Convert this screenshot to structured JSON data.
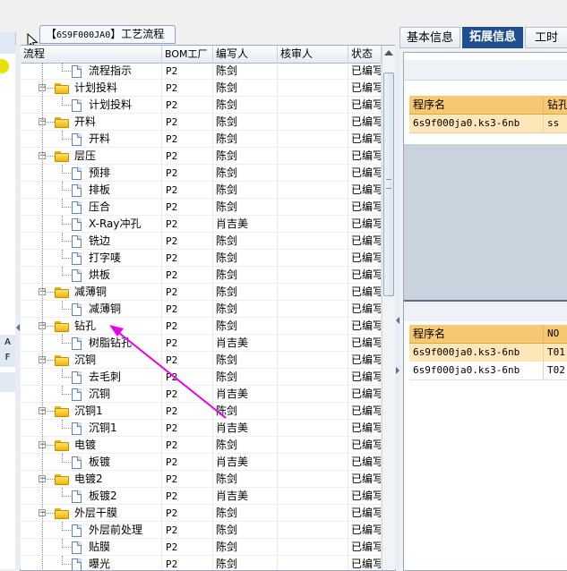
{
  "title_tab": {
    "code": "6S9F000JA0",
    "prefix": "【",
    "suffix": "】工艺流程"
  },
  "right_tabs": [
    {
      "label": "基本信息",
      "active": false
    },
    {
      "label": "拓展信息",
      "active": true
    },
    {
      "label": "工时",
      "active": false
    }
  ],
  "left_strip": {
    "text_a": "A",
    "text_b": "F"
  },
  "grid": {
    "headers": {
      "flow": "流程",
      "bom": "BOM工厂",
      "author": "编写人",
      "reviewer": "核审人",
      "status": "状态"
    },
    "rows": [
      {
        "level": 2,
        "name": "流程指示",
        "bom": "P2",
        "author": "陈剑",
        "reviewer": "",
        "status": "已编写"
      },
      {
        "level": 1,
        "name": "计划投料",
        "bom": "P2",
        "author": "陈剑",
        "reviewer": "",
        "status": "已编写"
      },
      {
        "level": 2,
        "name": "计划投料",
        "bom": "P2",
        "author": "陈剑",
        "reviewer": "",
        "status": "已编写"
      },
      {
        "level": 1,
        "name": "开料",
        "bom": "P2",
        "author": "陈剑",
        "reviewer": "",
        "status": "已编写"
      },
      {
        "level": 2,
        "name": "开料",
        "bom": "P2",
        "author": "陈剑",
        "reviewer": "",
        "status": "已编写"
      },
      {
        "level": 1,
        "name": "层压",
        "bom": "P2",
        "author": "陈剑",
        "reviewer": "",
        "status": "已编写"
      },
      {
        "level": 2,
        "name": "预排",
        "bom": "P2",
        "author": "陈剑",
        "reviewer": "",
        "status": "已编写"
      },
      {
        "level": 2,
        "name": "排板",
        "bom": "P2",
        "author": "陈剑",
        "reviewer": "",
        "status": "已编写"
      },
      {
        "level": 2,
        "name": "压合",
        "bom": "P2",
        "author": "陈剑",
        "reviewer": "",
        "status": "已编写"
      },
      {
        "level": 2,
        "name": "X-Ray冲孔",
        "bom": "P2",
        "author": "肖吉美",
        "reviewer": "",
        "status": "已编写"
      },
      {
        "level": 2,
        "name": "铣边",
        "bom": "P2",
        "author": "陈剑",
        "reviewer": "",
        "status": "已编写"
      },
      {
        "level": 2,
        "name": "打字唛",
        "bom": "P2",
        "author": "陈剑",
        "reviewer": "",
        "status": "已编写"
      },
      {
        "level": 2,
        "name": "烘板",
        "bom": "P2",
        "author": "陈剑",
        "reviewer": "",
        "status": "已编写"
      },
      {
        "level": 1,
        "name": "减薄铜",
        "bom": "P2",
        "author": "陈剑",
        "reviewer": "",
        "status": "已编写"
      },
      {
        "level": 2,
        "name": "减薄铜",
        "bom": "P2",
        "author": "陈剑",
        "reviewer": "",
        "status": "已编写"
      },
      {
        "level": 1,
        "name": "钻孔",
        "bom": "P2",
        "author": "陈剑",
        "reviewer": "",
        "status": "已编写"
      },
      {
        "level": 2,
        "name": "树脂钻孔",
        "bom": "P2",
        "author": "肖吉美",
        "reviewer": "",
        "status": "已编写"
      },
      {
        "level": 1,
        "name": "沉铜",
        "bom": "P2",
        "author": "陈剑",
        "reviewer": "",
        "status": "已编写"
      },
      {
        "level": 2,
        "name": "去毛刺",
        "bom": "P2",
        "author": "陈剑",
        "reviewer": "",
        "status": "已编写"
      },
      {
        "level": 2,
        "name": "沉铜",
        "bom": "P2",
        "author": "肖吉美",
        "reviewer": "",
        "status": "已编写"
      },
      {
        "level": 1,
        "name": "沉铜1",
        "bom": "P2",
        "author": "陈剑",
        "reviewer": "",
        "status": "已编写"
      },
      {
        "level": 2,
        "name": "沉铜1",
        "bom": "P2",
        "author": "肖吉美",
        "reviewer": "",
        "status": "已编写"
      },
      {
        "level": 1,
        "name": "电镀",
        "bom": "P2",
        "author": "陈剑",
        "reviewer": "",
        "status": "已编写"
      },
      {
        "level": 2,
        "name": "板镀",
        "bom": "P2",
        "author": "肖吉美",
        "reviewer": "",
        "status": "已编写"
      },
      {
        "level": 1,
        "name": "电镀2",
        "bom": "P2",
        "author": "陈剑",
        "reviewer": "",
        "status": "已编写"
      },
      {
        "level": 2,
        "name": "板镀2",
        "bom": "P2",
        "author": "肖吉美",
        "reviewer": "",
        "status": "已编写"
      },
      {
        "level": 1,
        "name": "外层干膜",
        "bom": "P2",
        "author": "陈剑",
        "reviewer": "",
        "status": "已编写"
      },
      {
        "level": 2,
        "name": "外层前处理",
        "bom": "P2",
        "author": "陈剑",
        "reviewer": "",
        "status": "已编写"
      },
      {
        "level": 2,
        "name": "贴膜",
        "bom": "P2",
        "author": "陈剑",
        "reviewer": "",
        "status": "已编写"
      },
      {
        "level": 2,
        "name": "曝光",
        "bom": "P2",
        "author": "陈剑",
        "reviewer": "",
        "status": "已编写"
      }
    ]
  },
  "program_table_top": {
    "headers": {
      "name": "程序名",
      "drill": "钻孔"
    },
    "rows": [
      {
        "name": "6s9f000ja0.ks3-6nb",
        "drill": "ss"
      }
    ]
  },
  "program_table_bottom": {
    "headers": {
      "name": "程序名",
      "no": "NO"
    },
    "rows": [
      {
        "name": "6s9f000ja0.ks3-6nb",
        "no": "T01",
        "highlight": true
      },
      {
        "name": "6s9f000ja0.ks3-6nb",
        "no": "T02",
        "highlight": false
      }
    ]
  },
  "colors": {
    "accent": "#1f4f8c",
    "row_highlight": "#fde6b8",
    "header_orange": "#f7c873",
    "annotation_arrow": "#e600e6"
  }
}
